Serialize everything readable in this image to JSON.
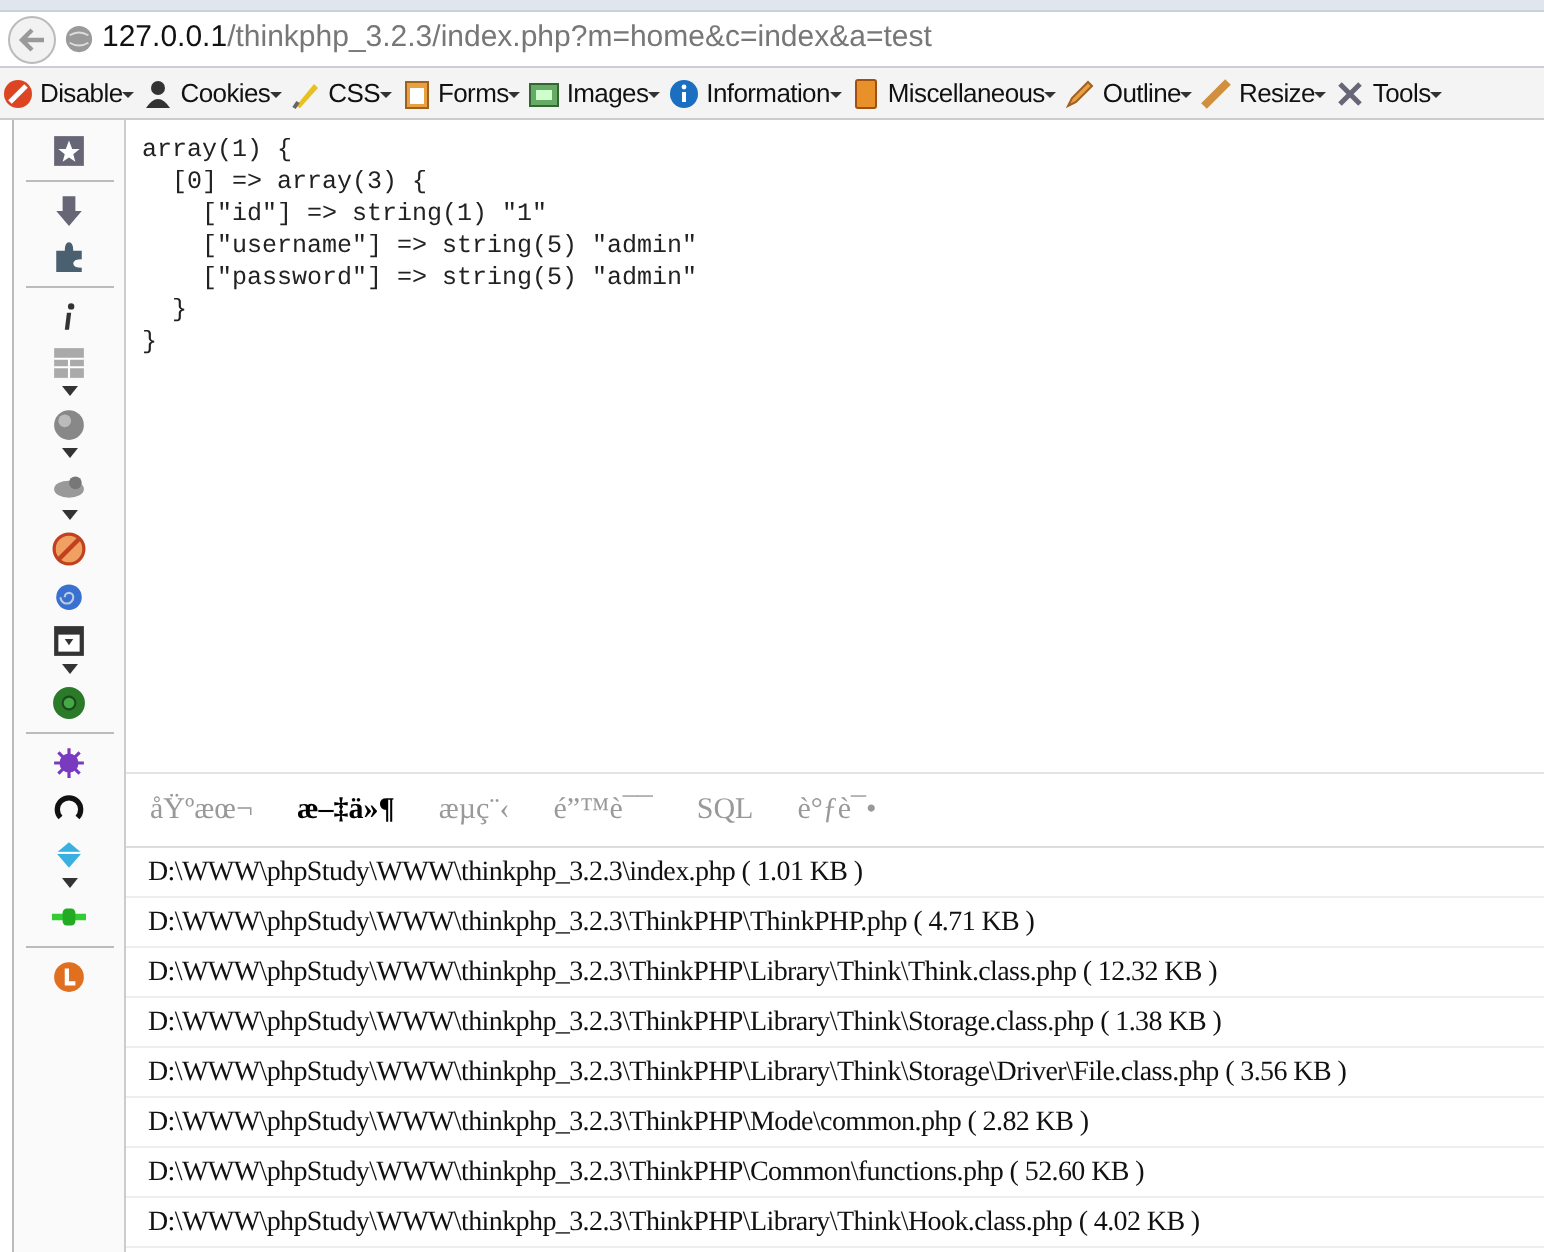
{
  "address_bar": {
    "host": "127.0.0.1",
    "path": "/thinkphp_3.2.3/index.php?m=home&c=index&a=test"
  },
  "toolbar": [
    {
      "label": "Disable"
    },
    {
      "label": "Cookies"
    },
    {
      "label": "CSS"
    },
    {
      "label": "Forms"
    },
    {
      "label": "Images"
    },
    {
      "label": "Information"
    },
    {
      "label": "Miscellaneous"
    },
    {
      "label": "Outline"
    },
    {
      "label": "Resize"
    },
    {
      "label": "Tools"
    }
  ],
  "output": [
    "array(1) {",
    "  [0] => array(3) {",
    "    [\"id\"] => string(1) \"1\"",
    "    [\"username\"] => string(5) \"admin\"",
    "    [\"password\"] => string(5) \"admin\"",
    "  }",
    "}"
  ],
  "trace": {
    "tabs": [
      {
        "label": "åŸºæœ¬",
        "selected": false
      },
      {
        "label": "æ–‡ä»¶",
        "selected": true
      },
      {
        "label": "æµç¨‹",
        "selected": false
      },
      {
        "label": "é”™è¯¯",
        "selected": false
      },
      {
        "label": "SQL",
        "selected": false
      },
      {
        "label": "è°ƒè¯•",
        "selected": false
      }
    ],
    "files": [
      "D:\\WWW\\phpStudy\\WWW\\thinkphp_3.2.3\\index.php ( 1.01 KB )",
      "D:\\WWW\\phpStudy\\WWW\\thinkphp_3.2.3\\ThinkPHP\\ThinkPHP.php ( 4.71 KB )",
      "D:\\WWW\\phpStudy\\WWW\\thinkphp_3.2.3\\ThinkPHP\\Library\\Think\\Think.class.php ( 12.32 KB )",
      "D:\\WWW\\phpStudy\\WWW\\thinkphp_3.2.3\\ThinkPHP\\Library\\Think\\Storage.class.php ( 1.38 KB )",
      "D:\\WWW\\phpStudy\\WWW\\thinkphp_3.2.3\\ThinkPHP\\Library\\Think\\Storage\\Driver\\File.class.php ( 3.56 KB )",
      "D:\\WWW\\phpStudy\\WWW\\thinkphp_3.2.3\\ThinkPHP\\Mode\\common.php ( 2.82 KB )",
      "D:\\WWW\\phpStudy\\WWW\\thinkphp_3.2.3\\ThinkPHP\\Common\\functions.php ( 52.60 KB )",
      "D:\\WWW\\phpStudy\\WWW\\thinkphp_3.2.3\\ThinkPHP\\Library\\Think\\Hook.class.php ( 4.02 KB )"
    ]
  }
}
